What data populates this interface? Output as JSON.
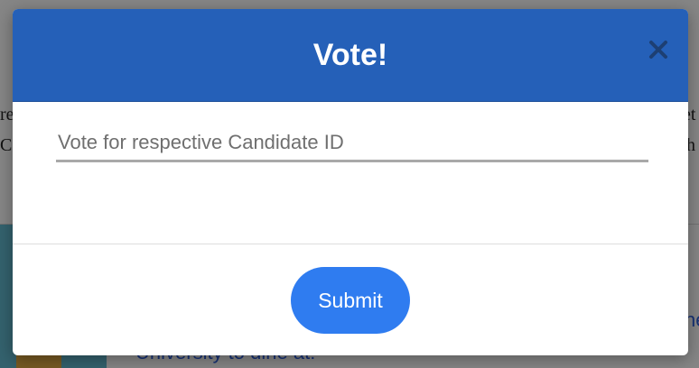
{
  "background": {
    "link_text": "University to dine at!",
    "left_edge_lines": [
      "re",
      "C"
    ],
    "right_edge_lines": [
      "et",
      "h"
    ],
    "right_edge_link": "he"
  },
  "modal": {
    "title": "Vote!",
    "close_icon": "close-icon",
    "input": {
      "value": "",
      "placeholder": "Vote for respective Candidate ID"
    },
    "submit_label": "Submit"
  },
  "colors": {
    "header": "#2560b8",
    "submit": "#2f7cf0",
    "close_icon": "#1d3f73"
  }
}
